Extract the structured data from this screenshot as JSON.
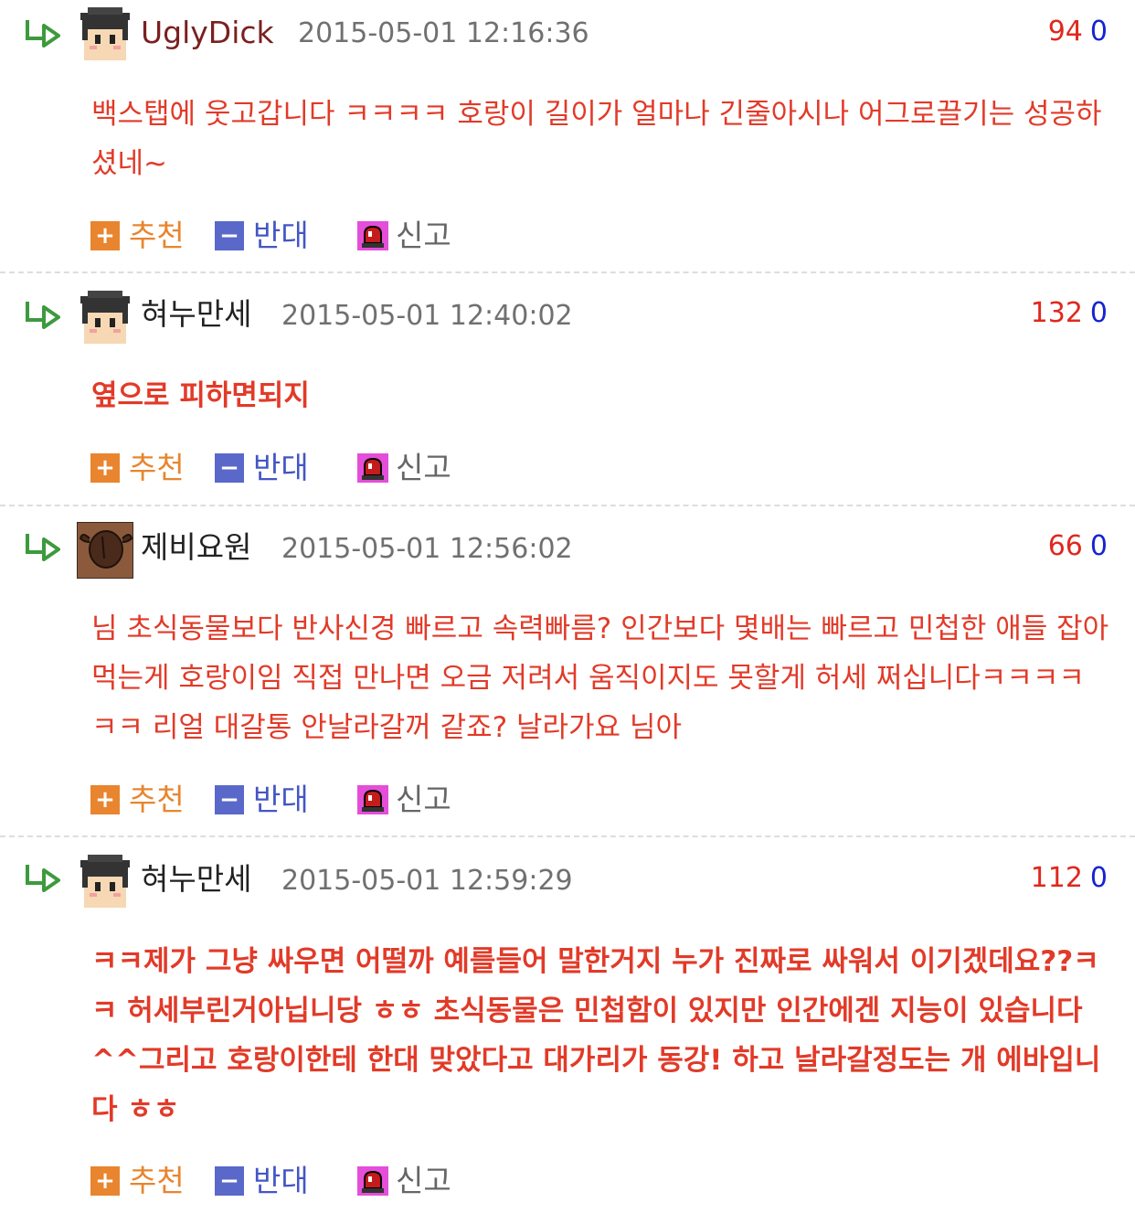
{
  "colors": {
    "comment_text": "#e23a28",
    "upvote": "#e0281e",
    "downvote": "#1624cf",
    "recommend": "#e8852e",
    "oppose": "#4456c4",
    "report_icon": "#e44ed9",
    "timestamp": "#707070"
  },
  "actions": {
    "recommend_label": "추천",
    "oppose_label": "반대",
    "report_label": "신고"
  },
  "comments": [
    {
      "username": "UglyDick",
      "timestamp": "2015-05-01 12:16:36",
      "upvotes": "94",
      "downvotes": "0",
      "avatar_icon": "student-cap-avatar-icon",
      "text": "백스탭에 웃고갑니다 ㅋㅋㅋㅋ 호랑이 길이가 얼마나 긴줄아시나 어그로끌기는 성공하셨네~"
    },
    {
      "username": "혀누만세",
      "timestamp": "2015-05-01 12:40:02",
      "upvotes": "132",
      "downvotes": "0",
      "avatar_icon": "student-cap-avatar-icon",
      "text": "옆으로 피하면되지"
    },
    {
      "username": "제비요원",
      "timestamp": "2015-05-01 12:56:02",
      "upvotes": "66",
      "downvotes": "0",
      "avatar_icon": "brown-face-avatar-icon",
      "text": "님 초식동물보다 반사신경 빠르고 속력빠름? 인간보다 몇배는 빠르고 민첩한 애들 잡아먹는게 호랑이임 직접 만나면 오금 저려서 움직이지도 못할게 허세 쩌십니다ㅋㅋㅋㅋㅋㅋ 리얼 대갈통 안날라갈꺼 같죠? 날라가요 님아"
    },
    {
      "username": "혀누만세",
      "timestamp": "2015-05-01 12:59:29",
      "upvotes": "112",
      "downvotes": "0",
      "avatar_icon": "student-cap-avatar-icon",
      "text": "ㅋㅋ제가 그냥 싸우면 어떨까 예를들어 말한거지 누가 진짜로 싸워서 이기겠데요??ㅋㅋ 허세부린거아닙니당 ㅎㅎ 초식동물은 민첩함이 있지만 인간에겐 지능이 있습니다 ^^그리고 호랑이한테 한대 맞았다고 대가리가 동강! 하고 날라갈정도는 개 에바입니다 ㅎㅎ"
    }
  ]
}
